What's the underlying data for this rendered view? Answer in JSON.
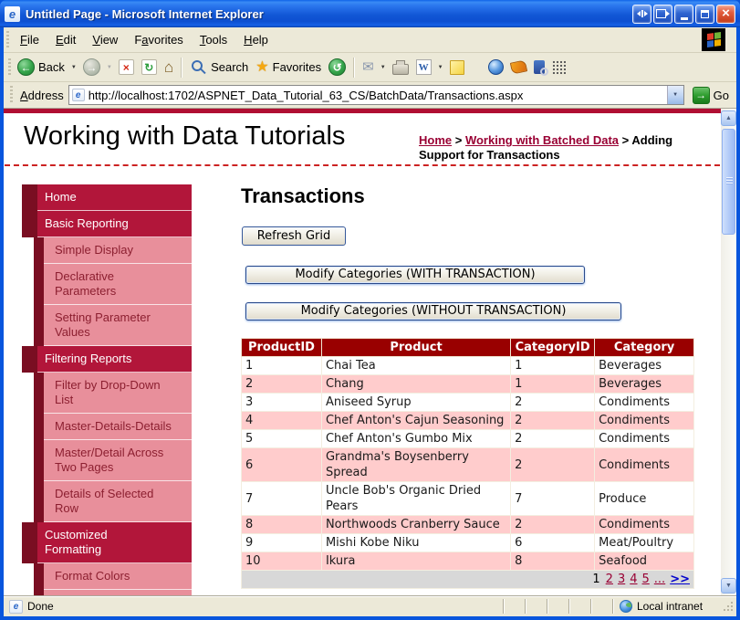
{
  "window": {
    "title": "Untitled Page - Microsoft Internet Explorer"
  },
  "menu": {
    "items": [
      {
        "label": "File",
        "accel": 0
      },
      {
        "label": "Edit",
        "accel": 0
      },
      {
        "label": "View",
        "accel": 0
      },
      {
        "label": "Favorites",
        "accel": 1
      },
      {
        "label": "Tools",
        "accel": 0
      },
      {
        "label": "Help",
        "accel": 0
      }
    ]
  },
  "toolbar": {
    "back": "Back",
    "search": "Search",
    "favorites": "Favorites"
  },
  "address": {
    "label": "Address",
    "url": "http://localhost:1702/ASPNET_Data_Tutorial_63_CS/BatchData/Transactions.aspx",
    "go": "Go"
  },
  "page": {
    "site_title": "Working with Data Tutorials",
    "breadcrumb": {
      "links": [
        {
          "text": "Home"
        },
        {
          "text": "Working with Batched Data"
        }
      ],
      "separator": ">",
      "current": "Adding Support for Transactions"
    },
    "sidebar": {
      "items": [
        {
          "label": "Home",
          "level": "top"
        },
        {
          "label": "Basic Reporting",
          "level": "top"
        },
        {
          "label": "Simple Display",
          "level": "sub"
        },
        {
          "label": "Declarative Parameters",
          "level": "sub"
        },
        {
          "label": "Setting Parameter Values",
          "level": "sub"
        },
        {
          "label": "Filtering Reports",
          "level": "top"
        },
        {
          "label": "Filter by Drop-Down List",
          "level": "sub"
        },
        {
          "label": "Master-Details-Details",
          "level": "sub"
        },
        {
          "label": "Master/Detail Across Two Pages",
          "level": "sub"
        },
        {
          "label": "Details of Selected Row",
          "level": "sub"
        },
        {
          "label": "Customized Formatting",
          "level": "top"
        },
        {
          "label": "Format Colors",
          "level": "sub"
        },
        {
          "label": "",
          "level": "sub"
        }
      ]
    },
    "main": {
      "heading": "Transactions",
      "buttons": {
        "refresh": "Refresh Grid",
        "with_transaction": "Modify Categories (WITH TRANSACTION)",
        "without_transaction": "Modify Categories (WITHOUT TRANSACTION)"
      },
      "table": {
        "headers": [
          "ProductID",
          "Product",
          "CategoryID",
          "Category"
        ],
        "rows": [
          [
            "1",
            "Chai Tea",
            "1",
            "Beverages"
          ],
          [
            "2",
            "Chang",
            "1",
            "Beverages"
          ],
          [
            "3",
            "Aniseed Syrup",
            "2",
            "Condiments"
          ],
          [
            "4",
            "Chef Anton's Cajun Seasoning",
            "2",
            "Condiments"
          ],
          [
            "5",
            "Chef Anton's Gumbo Mix",
            "2",
            "Condiments"
          ],
          [
            "6",
            "Grandma's Boysenberry Spread",
            "2",
            "Condiments"
          ],
          [
            "7",
            "Uncle Bob's Organic Dried Pears",
            "7",
            "Produce"
          ],
          [
            "8",
            "Northwoods Cranberry Sauce",
            "2",
            "Condiments"
          ],
          [
            "9",
            "Mishi Kobe Niku",
            "6",
            "Meat/Poultry"
          ],
          [
            "10",
            "Ikura",
            "8",
            "Seafood"
          ]
        ],
        "pager": {
          "items": [
            {
              "text": "1",
              "kind": "current"
            },
            {
              "text": "2",
              "kind": "page"
            },
            {
              "text": "3",
              "kind": "page"
            },
            {
              "text": "4",
              "kind": "page"
            },
            {
              "text": "5",
              "kind": "page"
            },
            {
              "text": "...",
              "kind": "page"
            },
            {
              "text": ">>",
              "kind": "next"
            }
          ]
        }
      }
    }
  },
  "status": {
    "done": "Done",
    "zone": "Local intranet"
  },
  "icons": {
    "ie_e": "e",
    "back_arrow": "←",
    "forward_arrow": "→",
    "stop": "×",
    "refresh": "↻",
    "home": "⌂",
    "favorites_star": "★",
    "history": "↺",
    "mail": "✉",
    "word": "W",
    "caret": "▼",
    "go_arrow": "→",
    "close": "×",
    "scroll_up": "▲",
    "scroll_down": "▼"
  },
  "colors": {
    "accent_crimson": "#b00f33",
    "sidebar_top": "#b2163a",
    "sidebar_edge": "#7a0e22",
    "sidebar_sub": "#e88f9b",
    "sidebar_sub_text": "#8c1f30",
    "grid_header": "#990000",
    "grid_alt_row": "#ffcccc",
    "pager_bg": "#d8d8d8",
    "pager_link": "#990033",
    "pager_next": "#0000cc",
    "breadcrumb_link": "#990033"
  }
}
